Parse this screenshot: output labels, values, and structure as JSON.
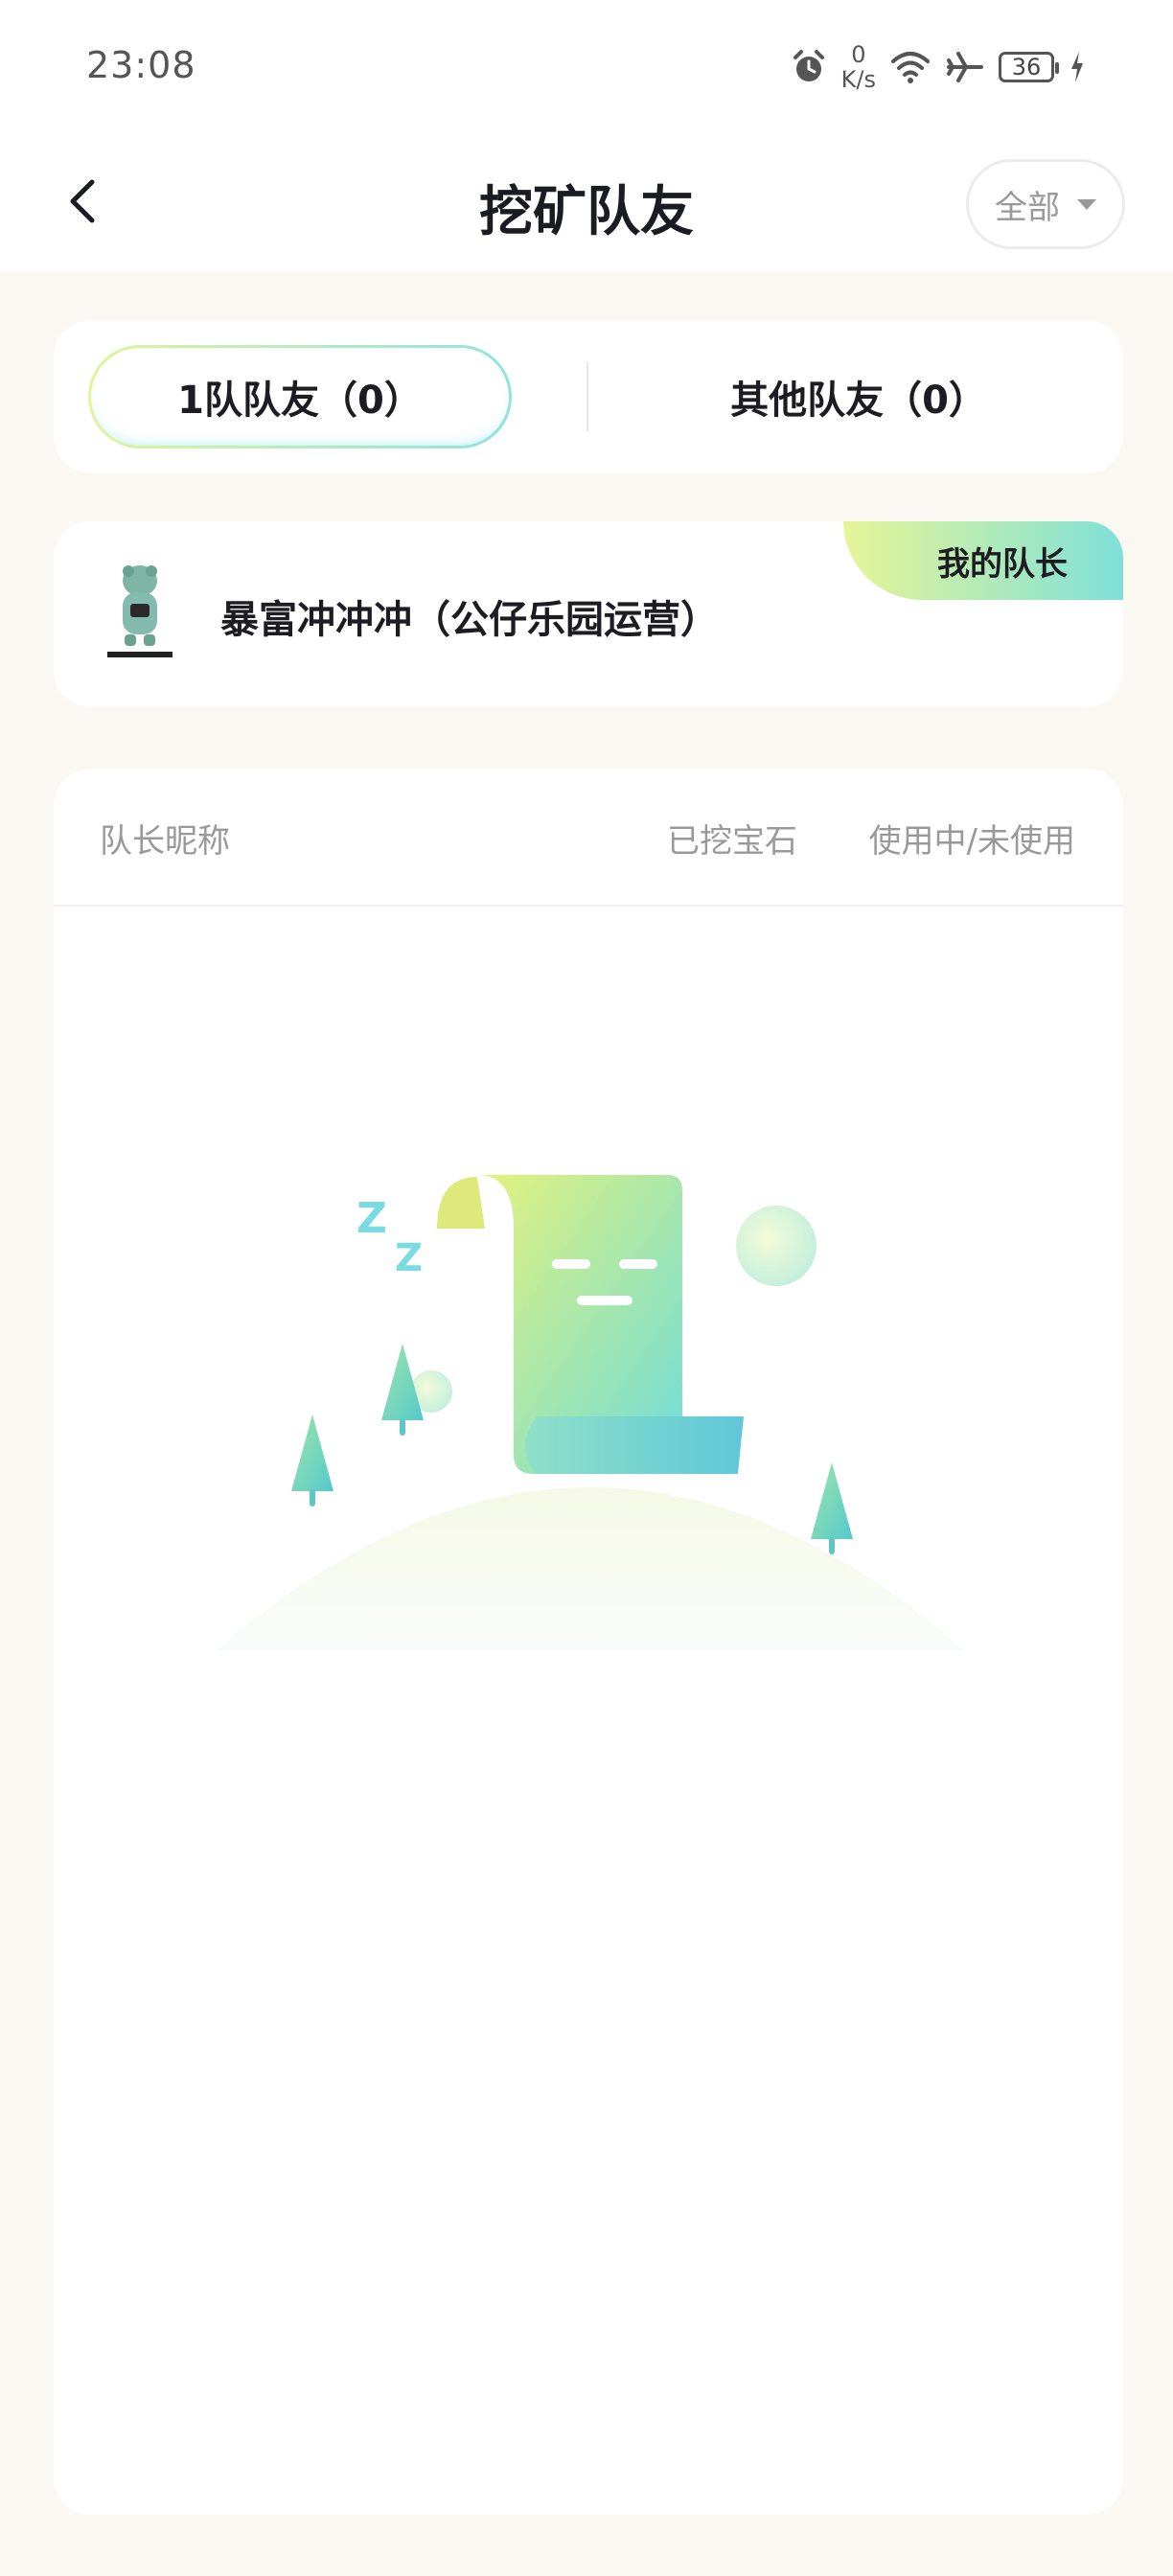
{
  "status_bar": {
    "time": "23:08",
    "speed_value": "0",
    "speed_unit": "K/s",
    "battery": "36",
    "icons": [
      "alarm-icon",
      "wifi-icon",
      "airplane-icon",
      "battery-icon",
      "charging-icon"
    ]
  },
  "nav": {
    "title": "挖矿队友",
    "filter_label": "全部"
  },
  "tabs": {
    "active_label": "1队队友（0）",
    "other_label": "其他队友（0）"
  },
  "captain": {
    "badge": "我的队长",
    "name": "暴富冲冲冲（公仔乐园运营）"
  },
  "list": {
    "col_nickname": "队长昵称",
    "col_mined": "已挖宝石",
    "col_status": "使用中/未使用"
  },
  "colors": {
    "accent_start": "#e6f596",
    "accent_end": "#7fe0d9",
    "background": "#fbf7f2"
  }
}
